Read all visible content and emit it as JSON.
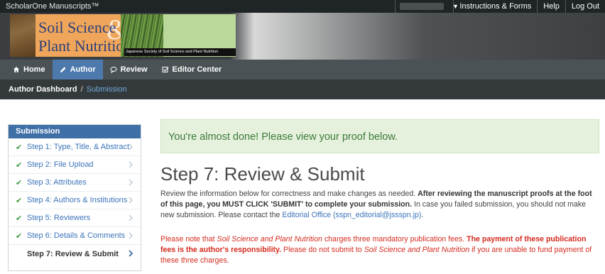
{
  "topbar": {
    "brand": "ScholarOne Manuscripts™",
    "links": [
      "Instructions & Forms",
      "Help",
      "Log Out"
    ]
  },
  "banner": {
    "journal_line1": "Soil Science",
    "journal_line2": "Plant Nutrition",
    "ampersand": "&",
    "society": "Japanese Society of Soil Science and Plant Nutrition"
  },
  "nav": {
    "tabs": [
      {
        "label": "Home",
        "icon": "home-icon",
        "active": false
      },
      {
        "label": "Author",
        "icon": "pencil-icon",
        "active": true
      },
      {
        "label": "Review",
        "icon": "speech-bubble-icon",
        "active": false
      },
      {
        "label": "Editor Center",
        "icon": "checkbox-icon",
        "active": false
      }
    ]
  },
  "breadcrumb": {
    "root": "Author Dashboard",
    "separator": "/",
    "current": "Submission"
  },
  "sidebar": {
    "title": "Submission",
    "steps": [
      {
        "label": "Step 1: Type, Title, & Abstract",
        "done": true
      },
      {
        "label": "Step 2: File Upload",
        "done": true
      },
      {
        "label": "Step 3: Attributes",
        "done": true
      },
      {
        "label": "Step 4: Authors & Institutions",
        "done": true
      },
      {
        "label": "Step 5: Reviewers",
        "done": true
      },
      {
        "label": "Step 6: Details & Comments",
        "done": true
      },
      {
        "label": "Step 7: Review & Submit",
        "done": false
      }
    ]
  },
  "main": {
    "alert": "You're almost done! Please view your proof below.",
    "title": "Step 7: Review & Submit",
    "intro_1": "Review the information below for correctness and make changes as needed. ",
    "intro_bold": "After reviewing the manuscript proofs at the foot of this page, you MUST CLICK 'SUBMIT' to complete your submission.",
    "intro_2": " In case you failed submission, you should not make new submission. Please contact the ",
    "intro_link": "Editorial Office (sspn_editorial@jssspn.jp)",
    "intro_3": ".",
    "fee_1": "Please note that ",
    "fee_journal": "Soil Science and Plant Nutrition",
    "fee_2": " charges three mandatory publication fees. ",
    "fee_bold": "The payment of these publication fees is the author's responsibility.",
    "fee_3": " Please do not submit to ",
    "fee_journal2": "Soil Science and Plant Nutrition",
    "fee_4": " if you are unable to fund payment of these three charges."
  },
  "colors": {
    "nav_active": "#4d79ad",
    "sidebar_header": "#3e6fa6",
    "link": "#3b73b9",
    "check": "#3f9a3f",
    "warning": "#d42b1e",
    "alert_bg": "#e6f1dd",
    "alert_text": "#3c7a3a"
  }
}
